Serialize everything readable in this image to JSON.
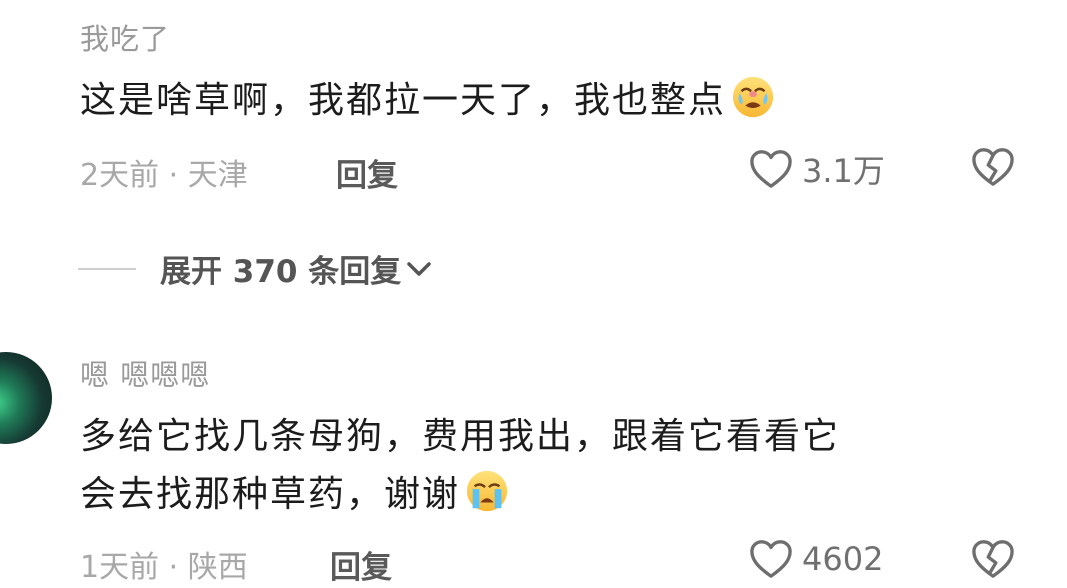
{
  "colors": {
    "background": "#ffffff",
    "username": "#9a9a9a",
    "text": "#1c1c1c",
    "meta": "#a8a8a8",
    "action": "#5a5a5a"
  },
  "comments": [
    {
      "username": "我吃了",
      "content": "这是啥草啊，我都拉一天了，我也整点",
      "emoji": "crying-face-emoji",
      "meta": "2天前 · 天津",
      "reply_label": "回复",
      "likes": "3.1万",
      "like_icon": "heart-outline-icon",
      "dislike_icon": "broken-heart-icon"
    },
    {
      "username": "嗯 嗯嗯嗯",
      "content_line1": "多给它找几条母狗，费用我出，跟着它看看它",
      "content_line2": "会去找那种草药，谢谢",
      "emoji": "loudly-crying-face-emoji",
      "meta": "1天前 · 陕西",
      "reply_label": "回复",
      "likes": "4602",
      "like_icon": "heart-outline-icon",
      "dislike_icon": "broken-heart-icon"
    }
  ],
  "expand_replies": {
    "label": "展开 370 条回复",
    "icon": "chevron-down-icon"
  }
}
